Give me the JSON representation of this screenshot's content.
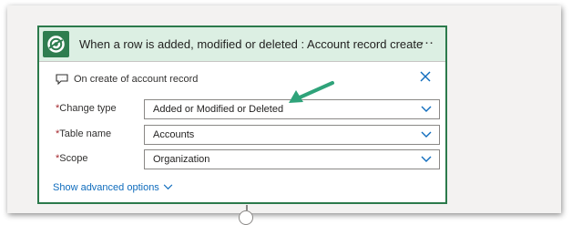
{
  "card": {
    "title": "When a row is added, modified or deleted : Account record create",
    "more_label": "…",
    "comment": "On create of account record",
    "fields": [
      {
        "label": "Change type",
        "required_mark": "*",
        "value": "Added or Modified or Deleted"
      },
      {
        "label": "Table name",
        "required_mark": "*",
        "value": "Accounts"
      },
      {
        "label": "Scope",
        "required_mark": "*",
        "value": "Organization"
      }
    ],
    "advanced_link": "Show advanced options"
  },
  "colors": {
    "header_bg": "#dcefe3",
    "card_border": "#2b7a4b",
    "link": "#0f6cbd",
    "annotation_arrow": "#2fa37a",
    "required": "#a4262c"
  },
  "icons": {
    "logo": "dataverse-icon",
    "more": "more-options-icon",
    "comment": "comment-icon",
    "close": "close-icon",
    "chevron": "chevron-down-icon",
    "add": "add-step-icon"
  }
}
